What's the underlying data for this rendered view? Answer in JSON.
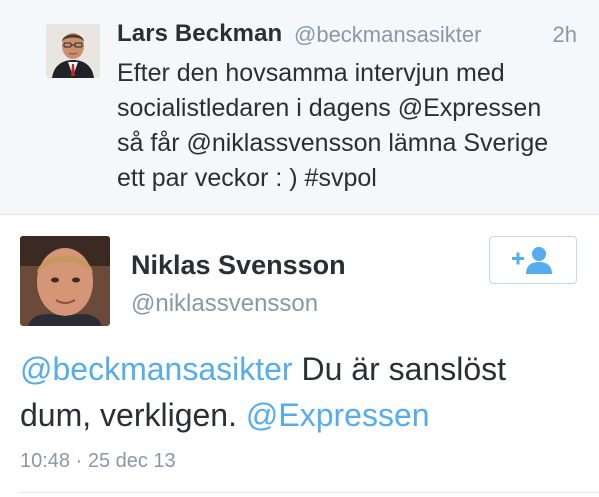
{
  "reply_context": {
    "name": "Lars Beckman",
    "handle": "@beckmansasikter",
    "time": "2h",
    "text_lines": [
      "Efter den hovsamma intervjun med",
      "socialistledaren i dagens @Expressen",
      "så får @niklassvensson lämna Sverige",
      "ett par veckor : )  #svpol"
    ]
  },
  "tweet": {
    "name": "Niklas Svensson",
    "handle": "@niklassvensson",
    "mention_1": "@beckmansasikter",
    "text_1": " Du är sanslöst",
    "text_2": "dum, verkligen. ",
    "mention_2": "@Expressen",
    "timestamp": "10:48 · 25 dec 13"
  },
  "icons": {
    "follow": "follow-user-icon",
    "context_avatar": "avatar",
    "main_avatar": "avatar"
  },
  "colors": {
    "link": "#55acee",
    "text": "#292f33",
    "muted": "#8899a6",
    "context_bg": "#f5f8fa"
  }
}
